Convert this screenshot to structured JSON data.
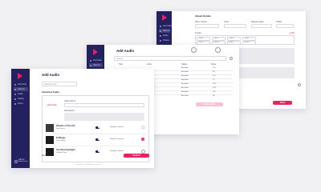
{
  "app": {
    "brand_color": "#e8225f",
    "sidebar_color": "#23215f",
    "nav": [
      "Overview",
      "Albums",
      "Audio",
      "Videos",
      "Users"
    ]
  },
  "back_window": {
    "section_title": "Album Details",
    "fields": [
      {
        "label": "Album Name"
      },
      {
        "label": "Artist"
      },
      {
        "label": "Release Date"
      },
      {
        "label": "Status"
      }
    ],
    "tracks_label": "Tracks",
    "add_label": "+ Add",
    "selected_tracks": [
      "Track 1",
      "Track 2",
      "Track 3",
      "Track 4",
      "Track 5",
      "Track 6",
      "Track 7",
      "Track 8"
    ],
    "save_label": "Save"
  },
  "middle_window": {
    "title": "Add Audio",
    "search_placeholder": "Search",
    "table_headers": [
      "Title",
      "Artist",
      "Status",
      "Plays"
    ],
    "rows": [
      {
        "title": "Cheap Thrills",
        "status": "Available",
        "plays": "120"
      },
      {
        "title": "Faded",
        "status": "Available",
        "plays": "95"
      },
      {
        "title": "Closer",
        "status": "Available",
        "plays": "210"
      },
      {
        "title": "Stay",
        "status": "Available",
        "plays": "78"
      },
      {
        "title": "Perfect",
        "status": "Available",
        "plays": "160"
      },
      {
        "title": "Believer",
        "status": "Available",
        "plays": "143"
      },
      {
        "title": "Thunder",
        "status": "Available",
        "plays": "101"
      },
      {
        "title": "Demons",
        "status": "Available",
        "plays": "88"
      }
    ],
    "add_button": "Add Audio"
  },
  "front_window": {
    "title": "Add Audio",
    "search_placeholder": "Search Audio",
    "attached_heading": "Attached Audio",
    "upload_label": "Add Audio",
    "field_label": "Audio Name",
    "field2_label": "Description",
    "tracks": [
      {
        "title": "Rhythm of The Girl",
        "artist": "Sam Jones",
        "status": "Ready for upload"
      },
      {
        "title": "El Mirage",
        "artist": "Ocean Eyes",
        "status": "Ready for upload"
      },
      {
        "title": "The Rival Spotlight",
        "artist": "Golden Pulse",
        "status": "Ready for upload"
      }
    ],
    "back_link": "Back",
    "submit_label": "Submit",
    "footer": "Copyright © 2024 All rights reserved",
    "user": {
      "name": "Admin",
      "role": "Administrator"
    }
  }
}
